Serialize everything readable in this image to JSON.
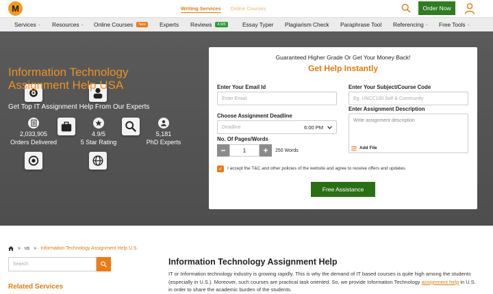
{
  "topbar": {
    "logo_letter": "M",
    "tabs": [
      {
        "label": "Writing Services",
        "active": true
      },
      {
        "label": "Online Courses",
        "active": false
      }
    ],
    "order_label": "Order Now"
  },
  "nav": {
    "items": [
      {
        "label": "Services",
        "caret": "⌄"
      },
      {
        "label": "Resources",
        "caret": "⌄"
      },
      {
        "label": "Online Courses",
        "badge": "New"
      },
      {
        "label": "Experts"
      },
      {
        "label": "Reviews",
        "badge": "4.9/5"
      },
      {
        "label": "Essay Typer"
      },
      {
        "label": "Plagiarism Check"
      },
      {
        "label": "Paraphrase Tool"
      },
      {
        "label": "Referencing",
        "caret": "⌄"
      },
      {
        "label": "Free Tools",
        "caret": "⌄"
      }
    ]
  },
  "hero": {
    "title": "Information Technology Assignment Help USA",
    "subtitle": "Get Top IT Assignment Help From Our Experts",
    "stats": [
      {
        "value": "2,033,905",
        "label": "Orders Delivered",
        "icon": "document-icon"
      },
      {
        "value": "4.9/5",
        "label": "5 Star Rating",
        "icon": "star-icon"
      },
      {
        "value": "5,181",
        "label": "PhD Experts",
        "icon": "graduate-icon"
      }
    ]
  },
  "form": {
    "guarantee": "Guaranteed Higher Grade Or Get Your Money Back!",
    "title": "Get Help Instantly",
    "email_label": "Enter Your Email Id",
    "email_placeholder": "Enter Email",
    "subject_label": "Enter Your Subject/Course Code",
    "subject_placeholder": "Eg. UNCC100 Self & Community",
    "deadline_label": "Choose Assignment Deadline",
    "deadline_placeholder": "Deadline",
    "deadline_time": "6:00 PM",
    "desc_label": "Enter Assignment Description",
    "desc_placeholder": "Write assignment description",
    "add_file": "Add File",
    "pages_label": "No. Of Pages/Words",
    "pages_value": "1",
    "words": "250 Words",
    "minus": "−",
    "plus": "+",
    "consent": "I accept the T&C and other policies of the website and agree to receive offers and updates.",
    "submit": "Free Assistance"
  },
  "breadcrumb": {
    "sep": "»",
    "items": [
      "us",
      "Information Technology Assignment Help U.S."
    ]
  },
  "sidebar": {
    "search_placeholder": "Search",
    "related_title": "Related Services"
  },
  "article": {
    "title": "Information Technology Assignment Help",
    "body_1": "IT or Information technology industry is growing rapidly. This is why the demand of IT based courses is quite high among the students (especially in U.S.). Moreover, such courses are practical task oriented. So, we provide Information Technology",
    "link": "assignment help",
    "body_2": " in U.S. in order to share the academic burden of the students."
  }
}
